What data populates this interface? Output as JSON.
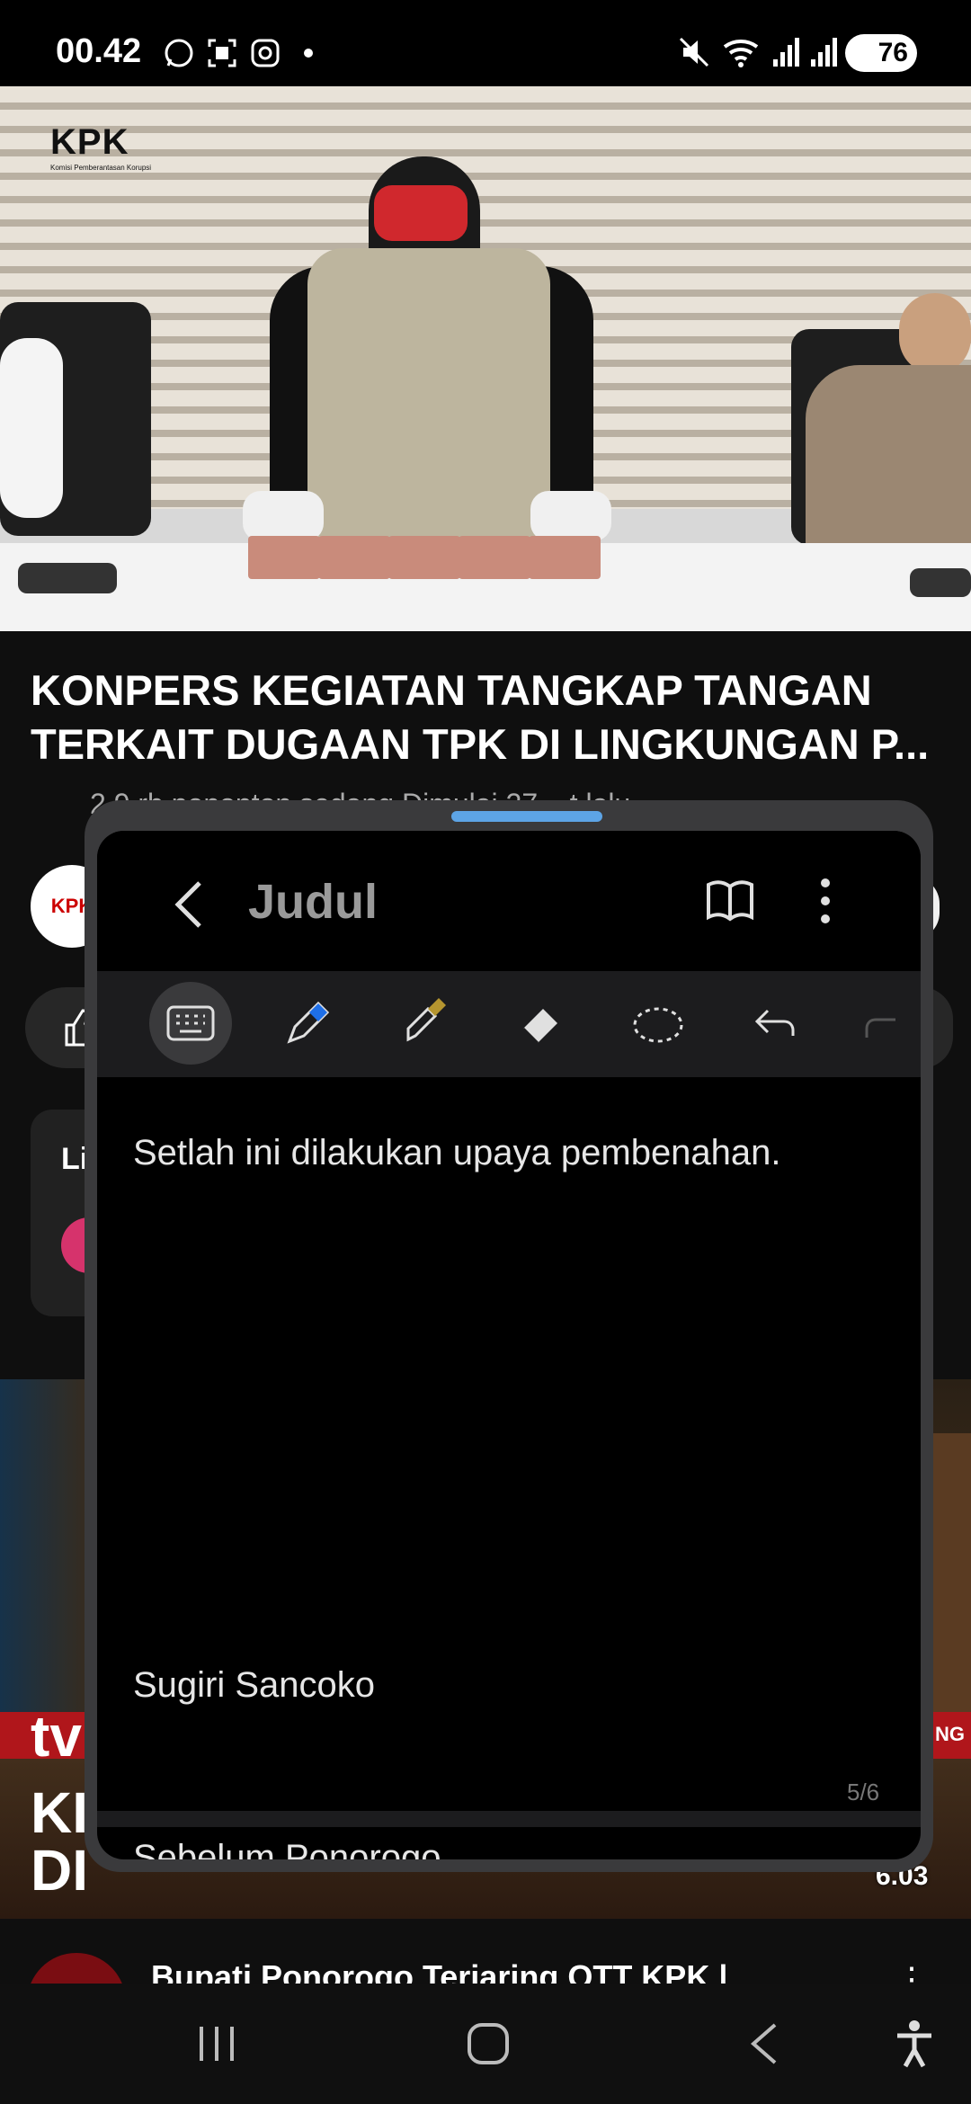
{
  "status_bar": {
    "time": "00.42",
    "battery": "76",
    "icons": [
      "whatsapp-icon",
      "screenshot-icon",
      "instagram-icon",
      "dot-icon",
      "mute-icon",
      "wifi-icon",
      "signal-icon",
      "signal-icon",
      "battery-icon"
    ]
  },
  "video": {
    "logo_text": "KPK",
    "logo_subtitle": "Komisi Pemberantasan Korupsi"
  },
  "video_info": {
    "title_line1": "KONPERS KEGIATAN TANGKAP TANGAN",
    "title_line2": "TERKAIT DUGAAN TPK DI LINGKUNGAN P...",
    "meta_partial": "2,9 rb penonton sedang    Dimulai 27 ...t lalu",
    "channel_avatar_text": "KPK",
    "live_card_label": "Li"
  },
  "next_video": {
    "thumb_text_brand": "tv",
    "thumb_text_k": "KI",
    "thumb_text_d": "DI",
    "thumb_banner_edge": "NG",
    "duration": "6.03",
    "title": "Bupati Ponorogo Terjaring OTT KPK |",
    "menu_icon": "more-vert-icon"
  },
  "note_window": {
    "title": "Judul",
    "tools": [
      "keyboard-icon",
      "pen-icon",
      "highlighter-icon",
      "eraser-icon",
      "lasso-icon",
      "undo-icon",
      "redo-icon"
    ],
    "body_text": "Setlah ini dilakukan upaya pembenahan.",
    "signature": "Sugiri Sancoko",
    "page_indicator": "5/6",
    "next_page_peek": "Sebelum Ponorogo"
  },
  "colors": {
    "accent_handle": "#5da4e6",
    "pen_blue": "#1e6fe8",
    "highlighter": "#b5952f"
  }
}
